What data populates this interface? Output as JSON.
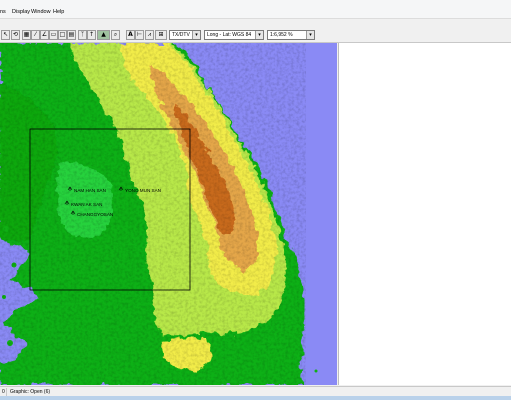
{
  "menu": {
    "items": [
      "ns",
      "Display",
      "Window",
      "Help"
    ]
  },
  "toolbar": {
    "projection": "TX/DTV",
    "coordinates": "Long - Lat: WGS 84",
    "scale": "1:6,952 %"
  },
  "map": {
    "sites": [
      {
        "name": "NAM HAN SAN"
      },
      {
        "name": "YONG MUN SAN"
      },
      {
        "name": "KWAN AK SAN"
      },
      {
        "name": "CHANGGYOSAN"
      }
    ],
    "colors": {
      "sea": "#0000ff",
      "lowland": "#00b000",
      "midland": "#ffff33",
      "highland": "#c86414"
    }
  },
  "statusbar": {
    "left": "0",
    "graphic": "Graphic: Open (6)"
  }
}
